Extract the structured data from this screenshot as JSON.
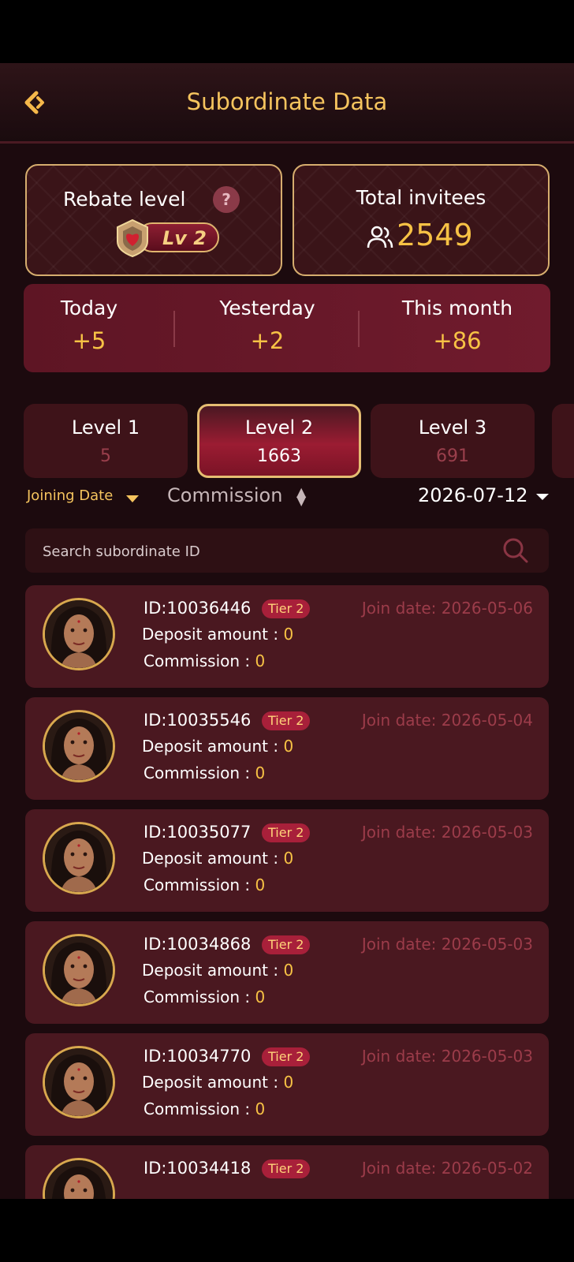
{
  "header": {
    "title": "Subordinate Data"
  },
  "rebate": {
    "label": "Rebate level",
    "help": "?",
    "level": "Lv 2"
  },
  "invitees": {
    "label": "Total invitees",
    "value": "2549"
  },
  "stats": [
    {
      "label": "Today",
      "value": "+5"
    },
    {
      "label": "Yesterday",
      "value": "+2"
    },
    {
      "label": "This month",
      "value": "+86"
    }
  ],
  "tabs": [
    {
      "label": "Level 1",
      "value": "5"
    },
    {
      "label": "Level 2",
      "value": "1663"
    },
    {
      "label": "Level 3",
      "value": "691"
    }
  ],
  "filters": {
    "joining_date": "Joining Date",
    "commission": "Commission",
    "date": "2026-07-12"
  },
  "search": {
    "placeholder": "Search subordinate ID"
  },
  "colors": {
    "accent": "#f7c245",
    "background": "#1c0a0e",
    "card": "#4a1820",
    "tier_badge": "#a8203a"
  },
  "subordinates": [
    {
      "id": "ID:10036446",
      "tier": "Tier 2",
      "join": "Join date: 2026-05-06",
      "deposit_label": "Deposit amount : ",
      "deposit": "0",
      "commission_label": "Commission : ",
      "commission": "0"
    },
    {
      "id": "ID:10035546",
      "tier": "Tier 2",
      "join": "Join date: 2026-05-04",
      "deposit_label": "Deposit amount : ",
      "deposit": "0",
      "commission_label": "Commission : ",
      "commission": "0"
    },
    {
      "id": "ID:10035077",
      "tier": "Tier 2",
      "join": "Join date: 2026-05-03",
      "deposit_label": "Deposit amount : ",
      "deposit": "0",
      "commission_label": "Commission : ",
      "commission": "0"
    },
    {
      "id": "ID:10034868",
      "tier": "Tier 2",
      "join": "Join date: 2026-05-03",
      "deposit_label": "Deposit amount : ",
      "deposit": "0",
      "commission_label": "Commission : ",
      "commission": "0"
    },
    {
      "id": "ID:10034770",
      "tier": "Tier 2",
      "join": "Join date: 2026-05-03",
      "deposit_label": "Deposit amount : ",
      "deposit": "0",
      "commission_label": "Commission : ",
      "commission": "0"
    },
    {
      "id": "ID:10034418",
      "tier": "Tier 2",
      "join": "Join date: 2026-05-02",
      "deposit_label": "",
      "deposit": "",
      "commission_label": "",
      "commission": ""
    }
  ]
}
